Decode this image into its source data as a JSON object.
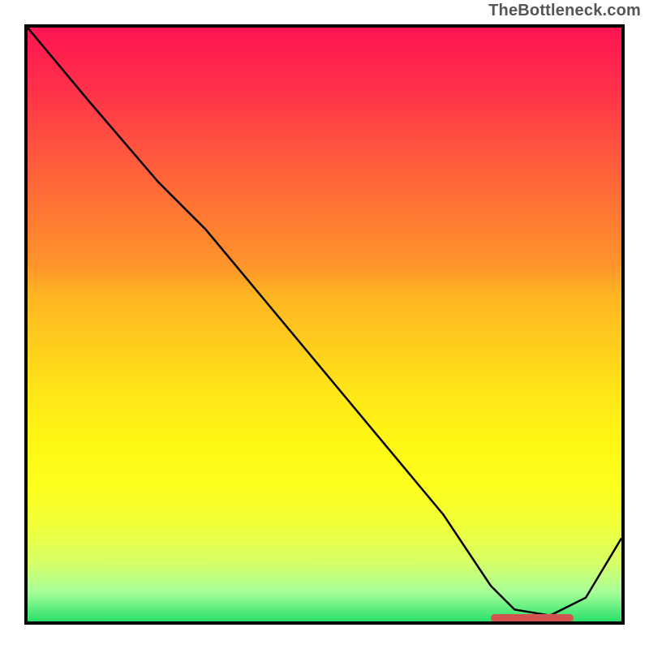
{
  "watermark": "TheBottleneck.com",
  "chart_data": {
    "type": "line",
    "title": "",
    "xlabel": "",
    "ylabel": "",
    "xlim": [
      0,
      100
    ],
    "ylim": [
      0,
      100
    ],
    "x": [
      0,
      10,
      22,
      30,
      40,
      50,
      60,
      70,
      78,
      82,
      88,
      94,
      100
    ],
    "values": [
      100,
      88,
      74,
      66,
      54,
      42,
      30,
      18,
      6,
      2,
      1,
      4,
      14
    ],
    "annotations": [
      {
        "kind": "marker-segment",
        "x_start": 78,
        "x_end": 92,
        "y": 0.5,
        "color": "#d4534f"
      }
    ]
  },
  "colors": {
    "frame": "#000000",
    "curve": "#000000",
    "marker": "#d4534f",
    "gradient_top": "#ff1452",
    "gradient_bottom": "#29e06a"
  }
}
